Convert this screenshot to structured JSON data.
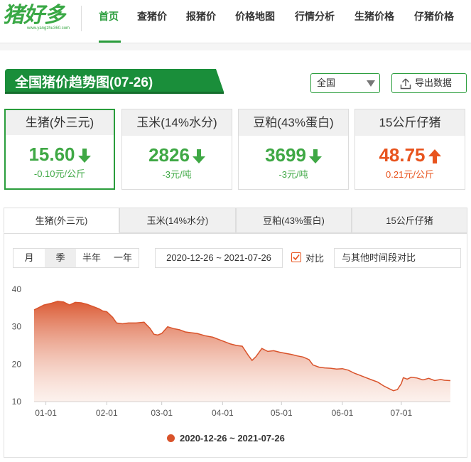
{
  "logo": {
    "text": "猪好多",
    "url": "www.yangzhu360.com"
  },
  "nav": {
    "items": [
      {
        "label": "首页",
        "active": true
      },
      {
        "label": "查猪价"
      },
      {
        "label": "报猪价"
      },
      {
        "label": "价格地图"
      },
      {
        "label": "行情分析"
      },
      {
        "label": "生猪价格"
      },
      {
        "label": "仔猪价格"
      }
    ]
  },
  "page": {
    "title": "全国猪价趋势图(07-26)"
  },
  "controls": {
    "region": "全国",
    "export_label": "导出数据"
  },
  "cards": [
    {
      "name": "生猪(外三元)",
      "value": "15.60",
      "change": "-0.10元/公斤",
      "trend": "down"
    },
    {
      "name": "玉米(14%水分)",
      "value": "2826",
      "change": "-3元/吨",
      "trend": "down"
    },
    {
      "name": "豆粕(43%蛋白)",
      "value": "3699",
      "change": "-3元/吨",
      "trend": "down"
    },
    {
      "name": "15公斤仔猪",
      "value": "48.75",
      "change": "0.21元/公斤",
      "trend": "up"
    }
  ],
  "tabs": [
    "生猪(外三元)",
    "玉米(14%水分)",
    "豆粕(43%蛋白)",
    "15公斤仔猪"
  ],
  "filters": {
    "periods": [
      "月",
      "季",
      "半年",
      "一年"
    ],
    "active_period": "季",
    "date_range": "2020-12-26 ~ 2021-07-26",
    "compare_label": "对比",
    "compare_placeholder": "与其他时间段对比"
  },
  "colors": {
    "brand_green": "#2a9d3c",
    "down": "#3fa845",
    "up": "#e8541e",
    "series": "#d9532b"
  },
  "chart_data": {
    "type": "area",
    "ylim": [
      10,
      40
    ],
    "yticks": [
      10,
      20,
      30,
      40
    ],
    "xticks": [
      "01-01",
      "02-01",
      "03-01",
      "04-01",
      "05-01",
      "06-01",
      "07-01"
    ],
    "xrange": [
      "2020-12-26",
      "2021-07-26"
    ],
    "grid": false,
    "legend": "bottom",
    "series": [
      {
        "name": "2020-12-26 ~ 2021-07-26",
        "points": [
          [
            "2020-12-26",
            34.5
          ],
          [
            "2020-12-28",
            35.0
          ],
          [
            "2020-12-31",
            35.8
          ],
          [
            "2021-01-04",
            36.3
          ],
          [
            "2021-01-07",
            36.8
          ],
          [
            "2021-01-10",
            36.6
          ],
          [
            "2021-01-13",
            35.8
          ],
          [
            "2021-01-16",
            36.5
          ],
          [
            "2021-01-19",
            36.4
          ],
          [
            "2021-01-22",
            36.0
          ],
          [
            "2021-01-25",
            35.4
          ],
          [
            "2021-01-28",
            34.8
          ],
          [
            "2021-01-30",
            34.2
          ],
          [
            "2021-02-01",
            34.0
          ],
          [
            "2021-02-04",
            32.5
          ],
          [
            "2021-02-06",
            31.0
          ],
          [
            "2021-02-09",
            30.8
          ],
          [
            "2021-02-12",
            31.0
          ],
          [
            "2021-02-16",
            31.0
          ],
          [
            "2021-02-20",
            31.2
          ],
          [
            "2021-02-23",
            29.6
          ],
          [
            "2021-02-25",
            28.0
          ],
          [
            "2021-02-27",
            27.8
          ],
          [
            "2021-03-01",
            28.2
          ],
          [
            "2021-03-04",
            30.0
          ],
          [
            "2021-03-07",
            29.5
          ],
          [
            "2021-03-10",
            29.2
          ],
          [
            "2021-03-13",
            28.6
          ],
          [
            "2021-03-16",
            28.4
          ],
          [
            "2021-03-19",
            28.2
          ],
          [
            "2021-03-23",
            27.6
          ],
          [
            "2021-03-27",
            27.2
          ],
          [
            "2021-03-30",
            26.6
          ],
          [
            "2021-04-02",
            26.0
          ],
          [
            "2021-04-05",
            25.4
          ],
          [
            "2021-04-08",
            25.0
          ],
          [
            "2021-04-11",
            24.8
          ],
          [
            "2021-04-14",
            22.4
          ],
          [
            "2021-04-16",
            21.0
          ],
          [
            "2021-04-18",
            22.0
          ],
          [
            "2021-04-21",
            24.2
          ],
          [
            "2021-04-24",
            23.4
          ],
          [
            "2021-04-27",
            23.6
          ],
          [
            "2021-04-30",
            23.2
          ],
          [
            "2021-05-03",
            22.9
          ],
          [
            "2021-05-06",
            22.6
          ],
          [
            "2021-05-09",
            22.2
          ],
          [
            "2021-05-12",
            21.9
          ],
          [
            "2021-05-15",
            21.2
          ],
          [
            "2021-05-17",
            19.8
          ],
          [
            "2021-05-20",
            19.2
          ],
          [
            "2021-05-23",
            19.0
          ],
          [
            "2021-05-26",
            18.9
          ],
          [
            "2021-05-29",
            18.7
          ],
          [
            "2021-06-01",
            18.8
          ],
          [
            "2021-06-04",
            18.4
          ],
          [
            "2021-06-07",
            17.6
          ],
          [
            "2021-06-10",
            17.0
          ],
          [
            "2021-06-13",
            16.4
          ],
          [
            "2021-06-16",
            15.8
          ],
          [
            "2021-06-19",
            15.2
          ],
          [
            "2021-06-22",
            14.2
          ],
          [
            "2021-06-25",
            13.4
          ],
          [
            "2021-06-27",
            12.9
          ],
          [
            "2021-06-29",
            13.2
          ],
          [
            "2021-07-01",
            14.8
          ],
          [
            "2021-07-02",
            16.4
          ],
          [
            "2021-07-04",
            16.0
          ],
          [
            "2021-07-06",
            16.5
          ],
          [
            "2021-07-09",
            16.3
          ],
          [
            "2021-07-12",
            15.8
          ],
          [
            "2021-07-15",
            16.2
          ],
          [
            "2021-07-18",
            15.6
          ],
          [
            "2021-07-21",
            15.9
          ],
          [
            "2021-07-23",
            15.7
          ],
          [
            "2021-07-26",
            15.6
          ]
        ]
      }
    ]
  }
}
